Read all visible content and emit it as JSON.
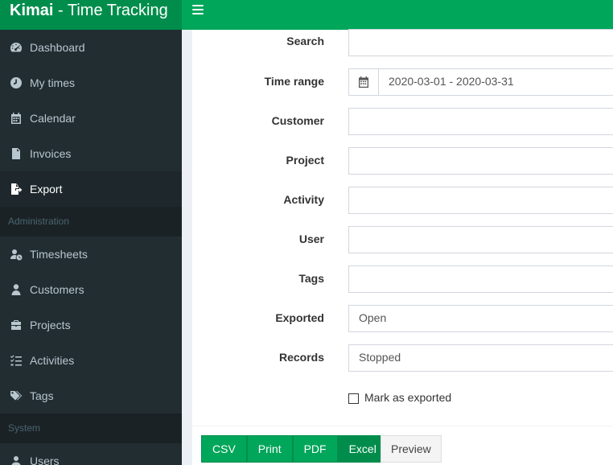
{
  "app": {
    "brand_bold": "Kimai",
    "brand_rest": " - Time Tracking"
  },
  "sidebar": {
    "items": [
      {
        "label": "Dashboard",
        "icon": "dashboard-icon"
      },
      {
        "label": "My times",
        "icon": "clock-icon"
      },
      {
        "label": "Calendar",
        "icon": "calendar-icon"
      },
      {
        "label": "Invoices",
        "icon": "invoice-icon"
      },
      {
        "label": "Export",
        "icon": "export-icon",
        "active": true
      }
    ],
    "admin_header": "Administration",
    "admin_items": [
      {
        "label": "Timesheets",
        "icon": "users-clock-icon"
      },
      {
        "label": "Customers",
        "icon": "user-tie-icon"
      },
      {
        "label": "Projects",
        "icon": "briefcase-icon"
      },
      {
        "label": "Activities",
        "icon": "list-icon"
      },
      {
        "label": "Tags",
        "icon": "tags-icon"
      }
    ],
    "system_header": "System",
    "system_items": [
      {
        "label": "Users",
        "icon": "users-icon"
      }
    ]
  },
  "form": {
    "search": {
      "label": "Search",
      "value": ""
    },
    "time_range": {
      "label": "Time range",
      "value": "2020-03-01 - 2020-03-31"
    },
    "customer": {
      "label": "Customer",
      "value": ""
    },
    "project": {
      "label": "Project",
      "value": ""
    },
    "activity": {
      "label": "Activity",
      "value": ""
    },
    "user": {
      "label": "User",
      "value": ""
    },
    "tags": {
      "label": "Tags",
      "value": ""
    },
    "exported": {
      "label": "Exported",
      "value": "Open"
    },
    "records": {
      "label": "Records",
      "value": "Stopped"
    },
    "mark_exported": {
      "label": "Mark as exported",
      "checked": false
    }
  },
  "actions": {
    "csv": "CSV",
    "print": "Print",
    "pdf": "PDF",
    "excel": "Excel",
    "preview": "Preview"
  },
  "colors": {
    "brand_green": "#00a65a",
    "brand_green_dark": "#008d4c",
    "sidebar_bg": "#222d32"
  }
}
